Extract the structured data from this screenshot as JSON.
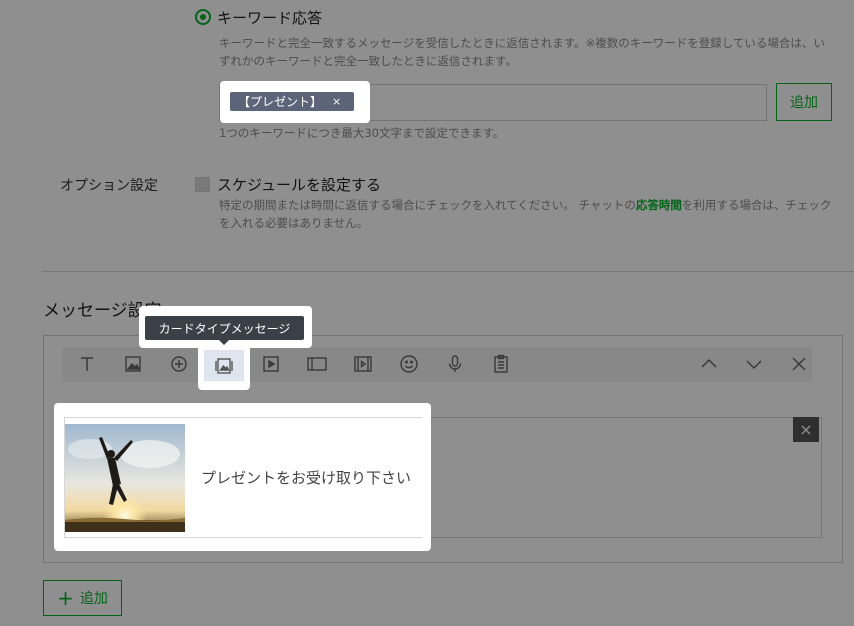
{
  "keyword_response": {
    "title": "キーワード応答",
    "description": "キーワードと完全一致するメッセージを受信したときに返信されます。※複数のキーワードを登録している場合は、いずれかのキーワードと完全一致したときに返信されます。",
    "keyword_tag": "【プレゼント】",
    "tag_remove": "×",
    "add_label": "追加",
    "limit_note": "1つのキーワードにつき最大30文字まで設定できます。"
  },
  "options": {
    "label": "オプション設定",
    "schedule_label": "スケジュールを設定する",
    "description_before": "特定の期間または時間に返信する場合にチェックを入れてください。 チャットの",
    "description_link": "応答時間",
    "description_after": "を利用する場合は、チェックを入れる必要はありません。"
  },
  "message_settings": {
    "title": "メッセージ設定",
    "tooltip": "カードタイプメッセージ",
    "toolbar_icons": [
      "text-icon",
      "image-icon",
      "coupon-icon",
      "card-type-icon",
      "video-icon",
      "rich-message-icon",
      "rich-video-icon",
      "sticker-icon",
      "voice-icon",
      "survey-icon"
    ],
    "card_text": "プレゼントをお受け取り下さい",
    "delete_label": "×",
    "add_label": "追加"
  },
  "colors": {
    "accent": "#06b32c",
    "tag_bg": "#5b6479",
    "tooltip_bg": "#3b3f47"
  }
}
